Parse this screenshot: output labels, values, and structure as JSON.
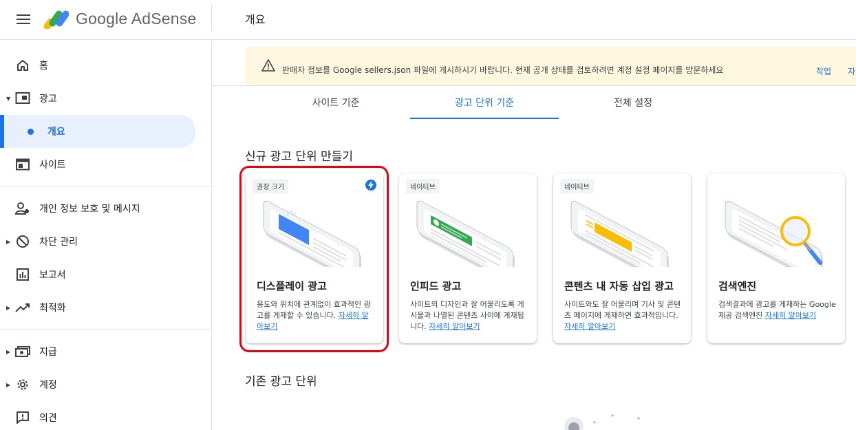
{
  "app": {
    "name": "Google AdSense",
    "page_title": "개요"
  },
  "sidebar": {
    "items": [
      {
        "label": "홈",
        "icon": "home-icon"
      },
      {
        "label": "광고",
        "icon": "ads-icon"
      },
      {
        "label": "개요",
        "icon": "dot-icon",
        "active": true
      },
      {
        "label": "사이트",
        "icon": "sites-icon"
      },
      {
        "label": "개인 정보 보호 및 메시지",
        "icon": "privacy-icon"
      },
      {
        "label": "차단 관리",
        "icon": "block-icon"
      },
      {
        "label": "보고서",
        "icon": "reports-icon"
      },
      {
        "label": "최적화",
        "icon": "optimization-icon"
      },
      {
        "label": "지급",
        "icon": "payments-icon"
      },
      {
        "label": "계정",
        "icon": "gear-icon"
      },
      {
        "label": "의견",
        "icon": "feedback-icon"
      }
    ]
  },
  "banner": {
    "text": "판매자 정보를 Google sellers.json 파일에 게시하시기 바랍니다. 현재 공개 상태를 검토하려면 계정 설정 페이지를 방문하세요",
    "action1": "작업",
    "action2": "자"
  },
  "tabs": [
    {
      "label": "사이트 기준"
    },
    {
      "label": "광고 단위 기준",
      "active": true
    },
    {
      "label": "전체 설정"
    }
  ],
  "sections": {
    "new_ad_units": "신규 광고 단위 만들기",
    "existing_ad_units": "기존 광고 단위"
  },
  "cards": [
    {
      "badge": "권장 크기",
      "title": "디스플레이 광고",
      "desc": "용도와 위치에 관계없이 효과적인 광고를 게재할 수 있습니다.",
      "link": "자세히 알아보기",
      "recommended": true
    },
    {
      "badge": "네이티브",
      "title": "인피드 광고",
      "desc": "사이트의 디자인과 잘 어울리도록 게시물과 나열된 콘텐츠 사이에 게재됩니다.",
      "link": "자세히 알아보기"
    },
    {
      "badge": "네이티브",
      "title": "콘텐츠 내 자동 삽입 광고",
      "desc": "사이트와도 잘 어울리며 기사 및 콘텐츠 페이지에 게재하면 효과적입니다.",
      "link": "자세히 알아보기"
    },
    {
      "badge": "",
      "title": "검색엔진",
      "desc": "검색결과에 광고를 게재하는 Google 제공 검색엔진",
      "link": "자세히 알아보기"
    }
  ],
  "colors": {
    "accent": "#1a73e8",
    "banner_bg": "#fef7e0",
    "highlight": "#e60012",
    "display_ad": "#4285f4",
    "infeed_ad": "#34a853",
    "incontent_ad": "#fbbc04"
  }
}
